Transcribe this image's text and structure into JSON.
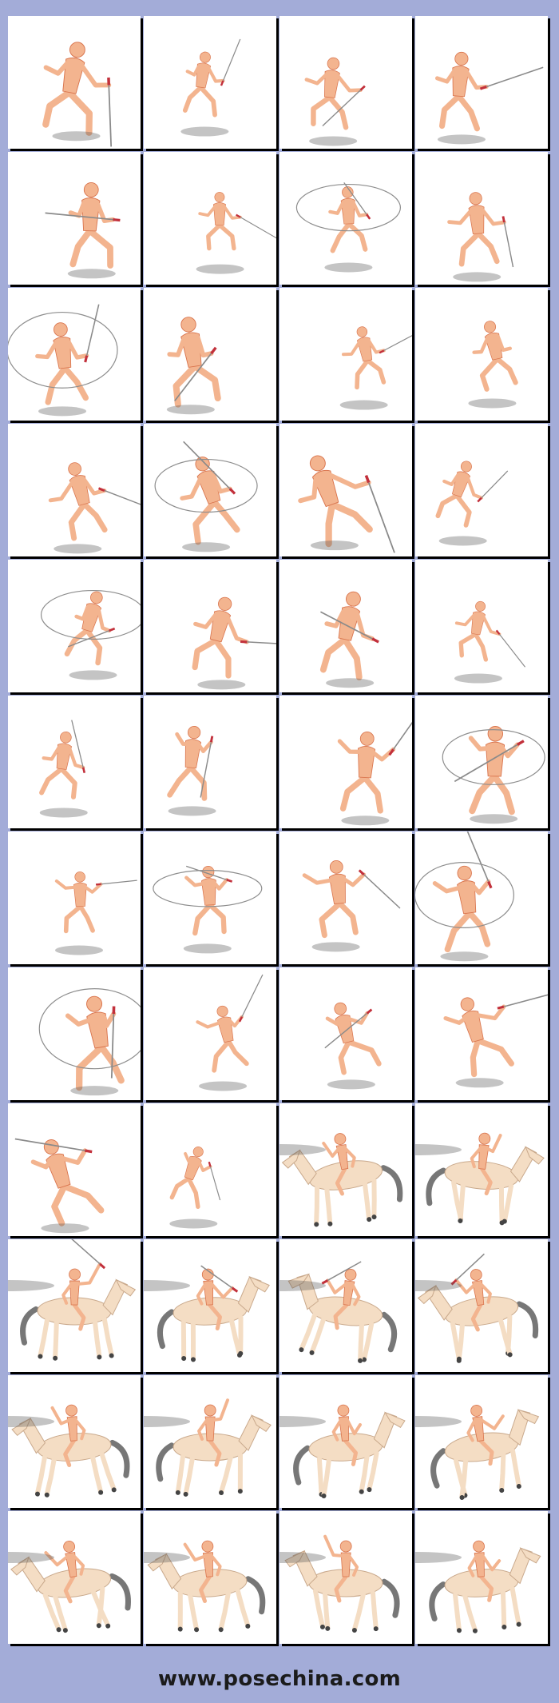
{
  "site_url": "www.posechina.com",
  "colors": {
    "background": "#a3acd8",
    "tile": "#ffffff",
    "skin": "#f3b48f",
    "skin_shade": "#d9744d",
    "horse": "#f4ddc4",
    "tail": "#777777",
    "blade": "#8a8a8a",
    "hilt": "#c2303b"
  },
  "tiles": [
    {
      "kind": "figure",
      "sword": true,
      "arc": false
    },
    {
      "kind": "figure",
      "sword": true,
      "arc": false
    },
    {
      "kind": "figure",
      "sword": true,
      "arc": false
    },
    {
      "kind": "figure",
      "sword": true,
      "arc": false
    },
    {
      "kind": "figure",
      "sword": true,
      "arc": false
    },
    {
      "kind": "figure",
      "sword": true,
      "arc": false
    },
    {
      "kind": "figure",
      "sword": true,
      "arc": true
    },
    {
      "kind": "figure",
      "sword": true,
      "arc": false
    },
    {
      "kind": "figure",
      "sword": true,
      "arc": true
    },
    {
      "kind": "figure",
      "sword": true,
      "arc": false
    },
    {
      "kind": "figure",
      "sword": true,
      "arc": false
    },
    {
      "kind": "figure",
      "sword": false,
      "arc": false
    },
    {
      "kind": "figure",
      "sword": true,
      "arc": false
    },
    {
      "kind": "figure",
      "sword": true,
      "arc": true
    },
    {
      "kind": "figure",
      "sword": true,
      "arc": false
    },
    {
      "kind": "figure",
      "sword": true,
      "arc": false
    },
    {
      "kind": "figure",
      "sword": true,
      "arc": true
    },
    {
      "kind": "figure",
      "sword": true,
      "arc": false
    },
    {
      "kind": "figure",
      "sword": true,
      "arc": false
    },
    {
      "kind": "figure",
      "sword": true,
      "arc": false
    },
    {
      "kind": "figure",
      "sword": true,
      "arc": false
    },
    {
      "kind": "figure",
      "sword": true,
      "arc": false
    },
    {
      "kind": "figure",
      "sword": true,
      "arc": false
    },
    {
      "kind": "figure",
      "sword": true,
      "arc": true
    },
    {
      "kind": "figure",
      "sword": true,
      "arc": false
    },
    {
      "kind": "figure",
      "sword": true,
      "arc": true
    },
    {
      "kind": "figure",
      "sword": true,
      "arc": false
    },
    {
      "kind": "figure",
      "sword": true,
      "arc": true
    },
    {
      "kind": "figure",
      "sword": true,
      "arc": true
    },
    {
      "kind": "figure",
      "sword": true,
      "arc": false
    },
    {
      "kind": "figure",
      "sword": true,
      "arc": false
    },
    {
      "kind": "figure",
      "sword": true,
      "arc": false
    },
    {
      "kind": "figure",
      "sword": true,
      "arc": false
    },
    {
      "kind": "figure",
      "sword": true,
      "arc": false
    },
    {
      "kind": "horse",
      "sword": false,
      "arc": false
    },
    {
      "kind": "horse",
      "sword": false,
      "arc": false
    },
    {
      "kind": "horse",
      "sword": true,
      "arc": false
    },
    {
      "kind": "horse",
      "sword": true,
      "arc": false
    },
    {
      "kind": "horse",
      "sword": true,
      "arc": false
    },
    {
      "kind": "horse",
      "sword": true,
      "arc": false
    },
    {
      "kind": "horse",
      "sword": false,
      "arc": false
    },
    {
      "kind": "horse",
      "sword": false,
      "arc": false
    },
    {
      "kind": "horse",
      "sword": false,
      "arc": false
    },
    {
      "kind": "horse",
      "sword": false,
      "arc": false
    },
    {
      "kind": "horse",
      "sword": false,
      "arc": false
    },
    {
      "kind": "horse",
      "sword": false,
      "arc": false
    },
    {
      "kind": "horse",
      "sword": false,
      "arc": false
    },
    {
      "kind": "horse",
      "sword": false,
      "arc": false
    }
  ]
}
